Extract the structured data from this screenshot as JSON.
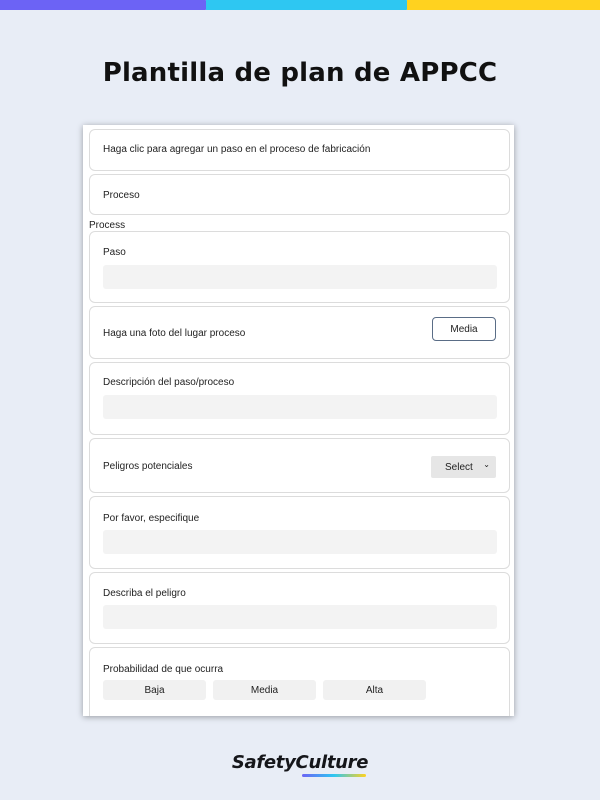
{
  "colors": {
    "accent_purple": "#6c63f5",
    "accent_cyan": "#2ec7f2",
    "accent_yellow": "#ffd21f",
    "background": "#e8edf6"
  },
  "page_title": "Plantilla de plan de APPCC",
  "form": {
    "add_step_prompt": "Haga clic para agregar un paso en el proceso de fabricación",
    "process_heading": "Proceso",
    "process_section_label": "Process",
    "step_label": "Paso",
    "step_value": "",
    "photo_label": "Haga una foto del lugar proceso",
    "media_button": "Media",
    "description_label": "Descripción del paso/proceso",
    "description_value": "",
    "hazards_label": "Peligros potenciales",
    "hazards_select": "Select",
    "specify_label": "Por favor, especifique",
    "specify_value": "",
    "describe_hazard_label": "Describa el peligro",
    "describe_hazard_value": "",
    "probability_label": "Probabilidad de que ocurra",
    "probability_options": [
      "Baja",
      "Media",
      "Alta"
    ]
  },
  "brand": {
    "logo": "SafetyCulture",
    "logo_icon": "safetyculture-logo"
  }
}
